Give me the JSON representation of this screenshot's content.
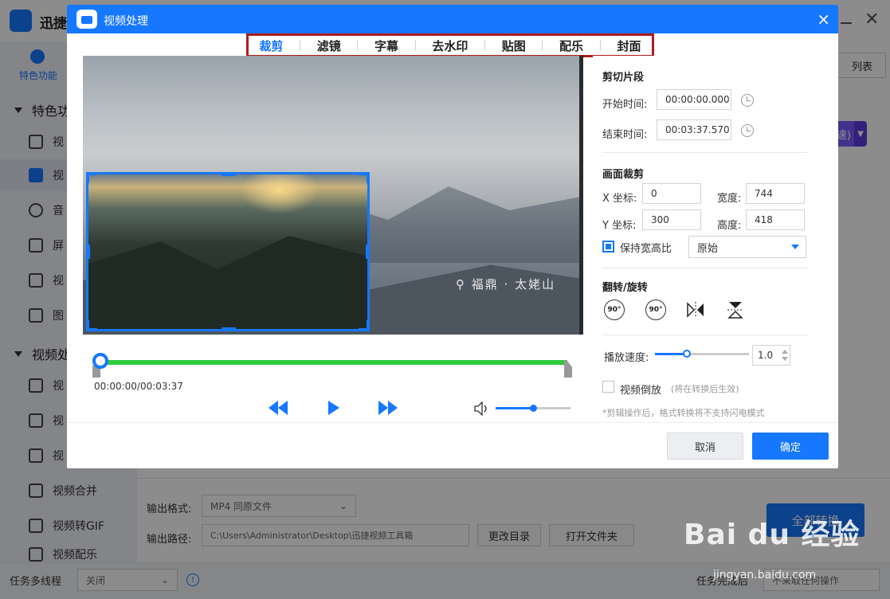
{
  "app": {
    "title": "迅捷",
    "featured_label": "特色功能",
    "list_btn": "列表",
    "sidebar_sections": [
      "特色功",
      "视频处"
    ],
    "sidebar_items_a": [
      "视",
      "视",
      "音",
      "屏",
      "视",
      "图"
    ],
    "sidebar_items_b": [
      "视",
      "视",
      "视",
      "视频合并",
      "视频转GIF",
      "视频配乐"
    ],
    "output_format_label": "输出格式:",
    "output_format_value": "MP4  同原文件",
    "output_path_label": "输出路径:",
    "output_path_value": "C:\\Users\\Administrator\\Desktop\\迅捷视频工具箱",
    "change_dir_btn": "更改目录",
    "open_folder_btn": "打开文件夹",
    "convert_all_btn": "全部转换",
    "multithread_label": "任务多线程",
    "multithread_value": "关闭",
    "task_done_label": "任务完成后",
    "task_done_value": "不采取任何操作",
    "right_partial": "速)"
  },
  "dialog": {
    "title": "视频处理",
    "close": "×",
    "tabs": [
      "裁剪",
      "滤镜",
      "字幕",
      "去水印",
      "贴图",
      "配乐",
      "封面"
    ],
    "active_tab": 0,
    "video_watermark": "福鼎 · 太姥山",
    "timecode": "00:00:00/00:03:37",
    "volume_level": 0.5,
    "clip_section": "剪切片段",
    "start_label": "开始时间:",
    "start_value": "00:00:00.000",
    "end_label": "结束时间:",
    "end_value": "00:03:37.570",
    "crop_section": "画面裁剪",
    "x_label": "X 坐标:",
    "x_value": "0",
    "y_label": "Y 坐标:",
    "y_value": "300",
    "width_label": "宽度:",
    "width_value": "744",
    "height_label": "高度:",
    "height_value": "418",
    "keep_ratio_label": "保持宽高比",
    "ratio_value": "原始",
    "flip_section": "翻转/旋转",
    "rotate_cw": "90°",
    "rotate_ccw": "90°",
    "speed_label": "播放速度:",
    "speed_value": "1.0",
    "speed_level": 0.34,
    "reverse_label": "视频倒放",
    "reverse_hint": "(将在转换后生效)",
    "note": "*剪辑操作后，格式转换将不支持闪电模式",
    "cancel": "取消",
    "ok": "确定"
  },
  "watermark": {
    "brand": "Bai du 经验",
    "url": "jingyan.baidu.com"
  },
  "colors": {
    "accent": "#1677ff",
    "timeline": "#2ecc40",
    "tab_highlight": "#b01c1c"
  }
}
